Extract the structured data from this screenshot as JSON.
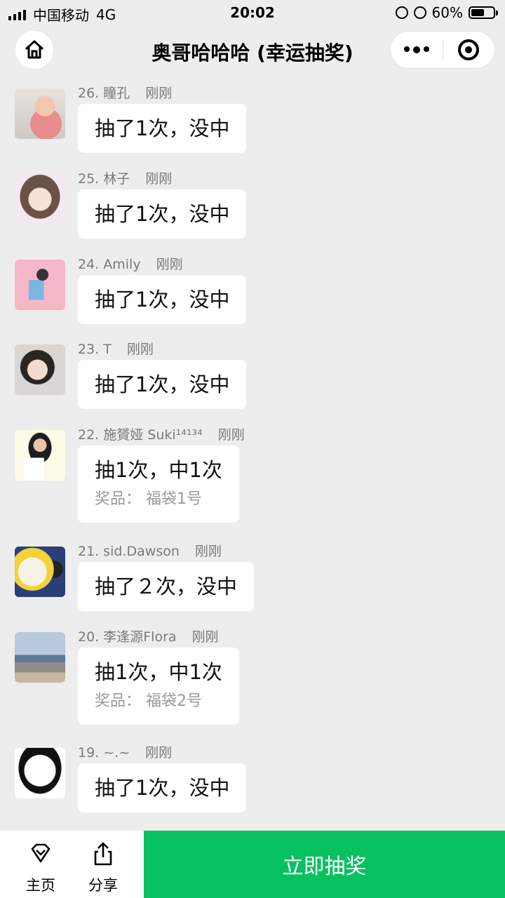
{
  "status_bar": {
    "carrier": "中国移动",
    "network": "4G",
    "time": "20:02",
    "battery": "60%",
    "battery_level": 0.6
  },
  "nav": {
    "title": "奥哥哈哈哈 (幸运抽奖)"
  },
  "records": [
    {
      "name": "26. 瞳孔",
      "time": "刚刚",
      "result": "抽了1次，没中",
      "prize": ""
    },
    {
      "name": "25. 林子",
      "time": "刚刚",
      "result": "抽了1次，没中",
      "prize": ""
    },
    {
      "name": "24. Amily",
      "time": "刚刚",
      "result": "抽了1次，没中",
      "prize": ""
    },
    {
      "name": "23. T",
      "time": "刚刚",
      "result": "抽了1次，没中",
      "prize": ""
    },
    {
      "name": "22. 施贇娅 Suki¹⁴¹³⁴",
      "time": "刚刚",
      "result": "抽1次，中1次",
      "prize": "奖品：  福袋1号"
    },
    {
      "name": "21. sid.Dawson",
      "time": "刚刚",
      "result": "抽了２次，没中",
      "prize": ""
    },
    {
      "name": "20. 李逢源Flora",
      "time": "刚刚",
      "result": "抽1次，中1次",
      "prize": "奖品：  福袋2号"
    },
    {
      "name": "19. ~.~",
      "time": "刚刚",
      "result": "抽了1次，没中",
      "prize": ""
    }
  ],
  "bottom": {
    "home_label": "主页",
    "share_label": "分享",
    "draw_label": "立即抽奖"
  },
  "colors": {
    "accent": "#07c160",
    "background": "#ededed"
  }
}
